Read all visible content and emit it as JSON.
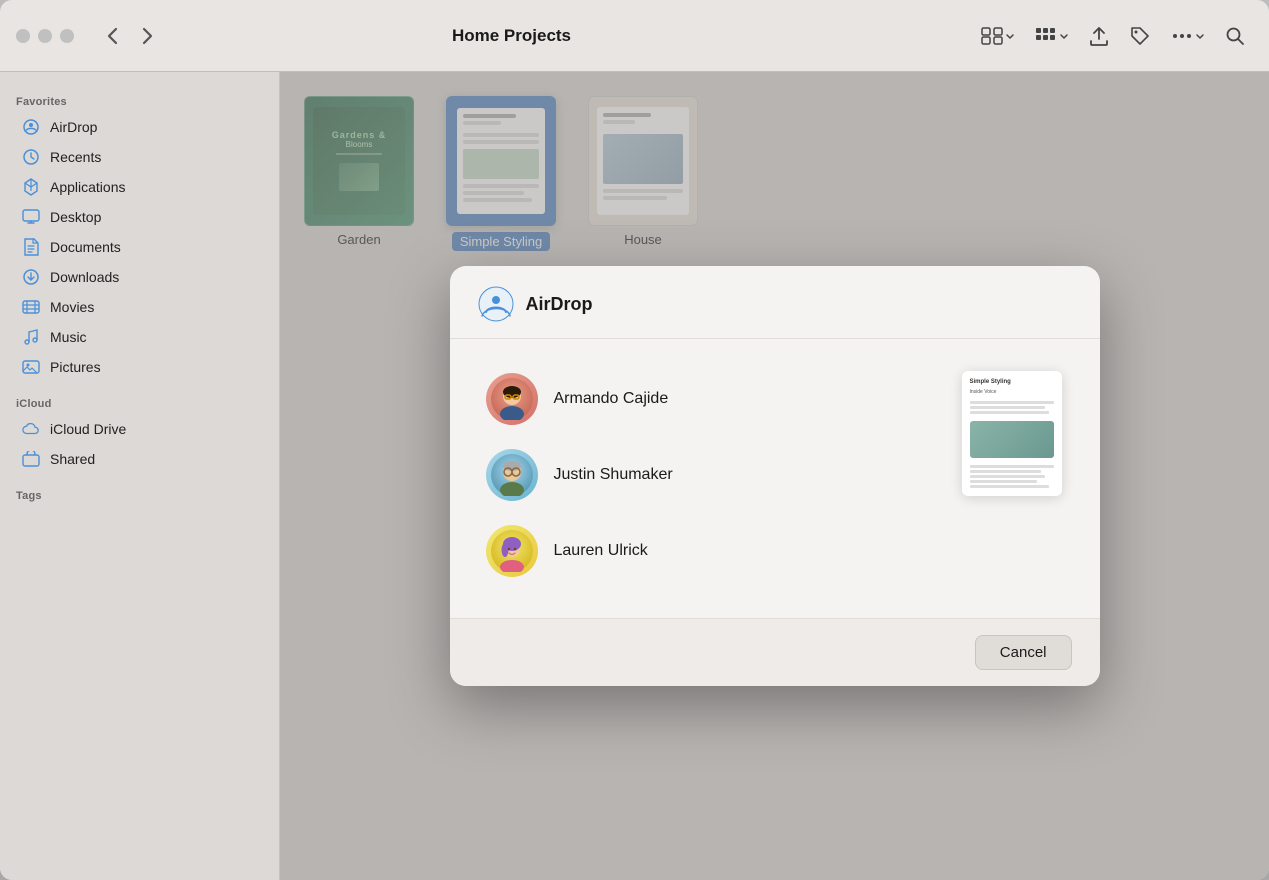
{
  "window": {
    "title": "Home Projects"
  },
  "toolbar": {
    "back_label": "‹",
    "forward_label": "›",
    "title": "Home Projects",
    "view_grid_label": "⊞",
    "share_label": "↑",
    "tag_label": "◇",
    "more_label": "•••",
    "search_label": "⌕"
  },
  "sidebar": {
    "favorites_label": "Favorites",
    "icloud_label": "iCloud",
    "tags_label": "Tags",
    "items": [
      {
        "id": "airdrop",
        "label": "AirDrop",
        "icon": "airdrop"
      },
      {
        "id": "recents",
        "label": "Recents",
        "icon": "recents"
      },
      {
        "id": "applications",
        "label": "Applications",
        "icon": "applications"
      },
      {
        "id": "desktop",
        "label": "Desktop",
        "icon": "desktop"
      },
      {
        "id": "documents",
        "label": "Documents",
        "icon": "documents"
      },
      {
        "id": "downloads",
        "label": "Downloads",
        "icon": "downloads"
      },
      {
        "id": "movies",
        "label": "Movies",
        "icon": "movies"
      },
      {
        "id": "music",
        "label": "Music",
        "icon": "music"
      },
      {
        "id": "pictures",
        "label": "Pictures",
        "icon": "pictures"
      }
    ],
    "icloud_items": [
      {
        "id": "icloud-drive",
        "label": "iCloud Drive",
        "icon": "icloud"
      },
      {
        "id": "shared",
        "label": "Shared",
        "icon": "shared"
      }
    ]
  },
  "files": [
    {
      "id": "garden",
      "label": "Garden",
      "selected": false
    },
    {
      "id": "simple-styling",
      "label": "Simple Styling",
      "selected": true
    },
    {
      "id": "house",
      "label": "House",
      "selected": false
    }
  ],
  "airdrop_modal": {
    "title": "AirDrop",
    "contacts": [
      {
        "id": "armando",
        "name": "Armando Cajide",
        "avatar_emoji": "🧔"
      },
      {
        "id": "justin",
        "name": "Justin Shumaker",
        "avatar_emoji": "🧓"
      },
      {
        "id": "lauren",
        "name": "Lauren Ulrick",
        "avatar_emoji": "👩‍🎨"
      }
    ],
    "preview": {
      "title": "Simple Styling",
      "subtitle": "Inside Voice"
    },
    "cancel_label": "Cancel"
  }
}
